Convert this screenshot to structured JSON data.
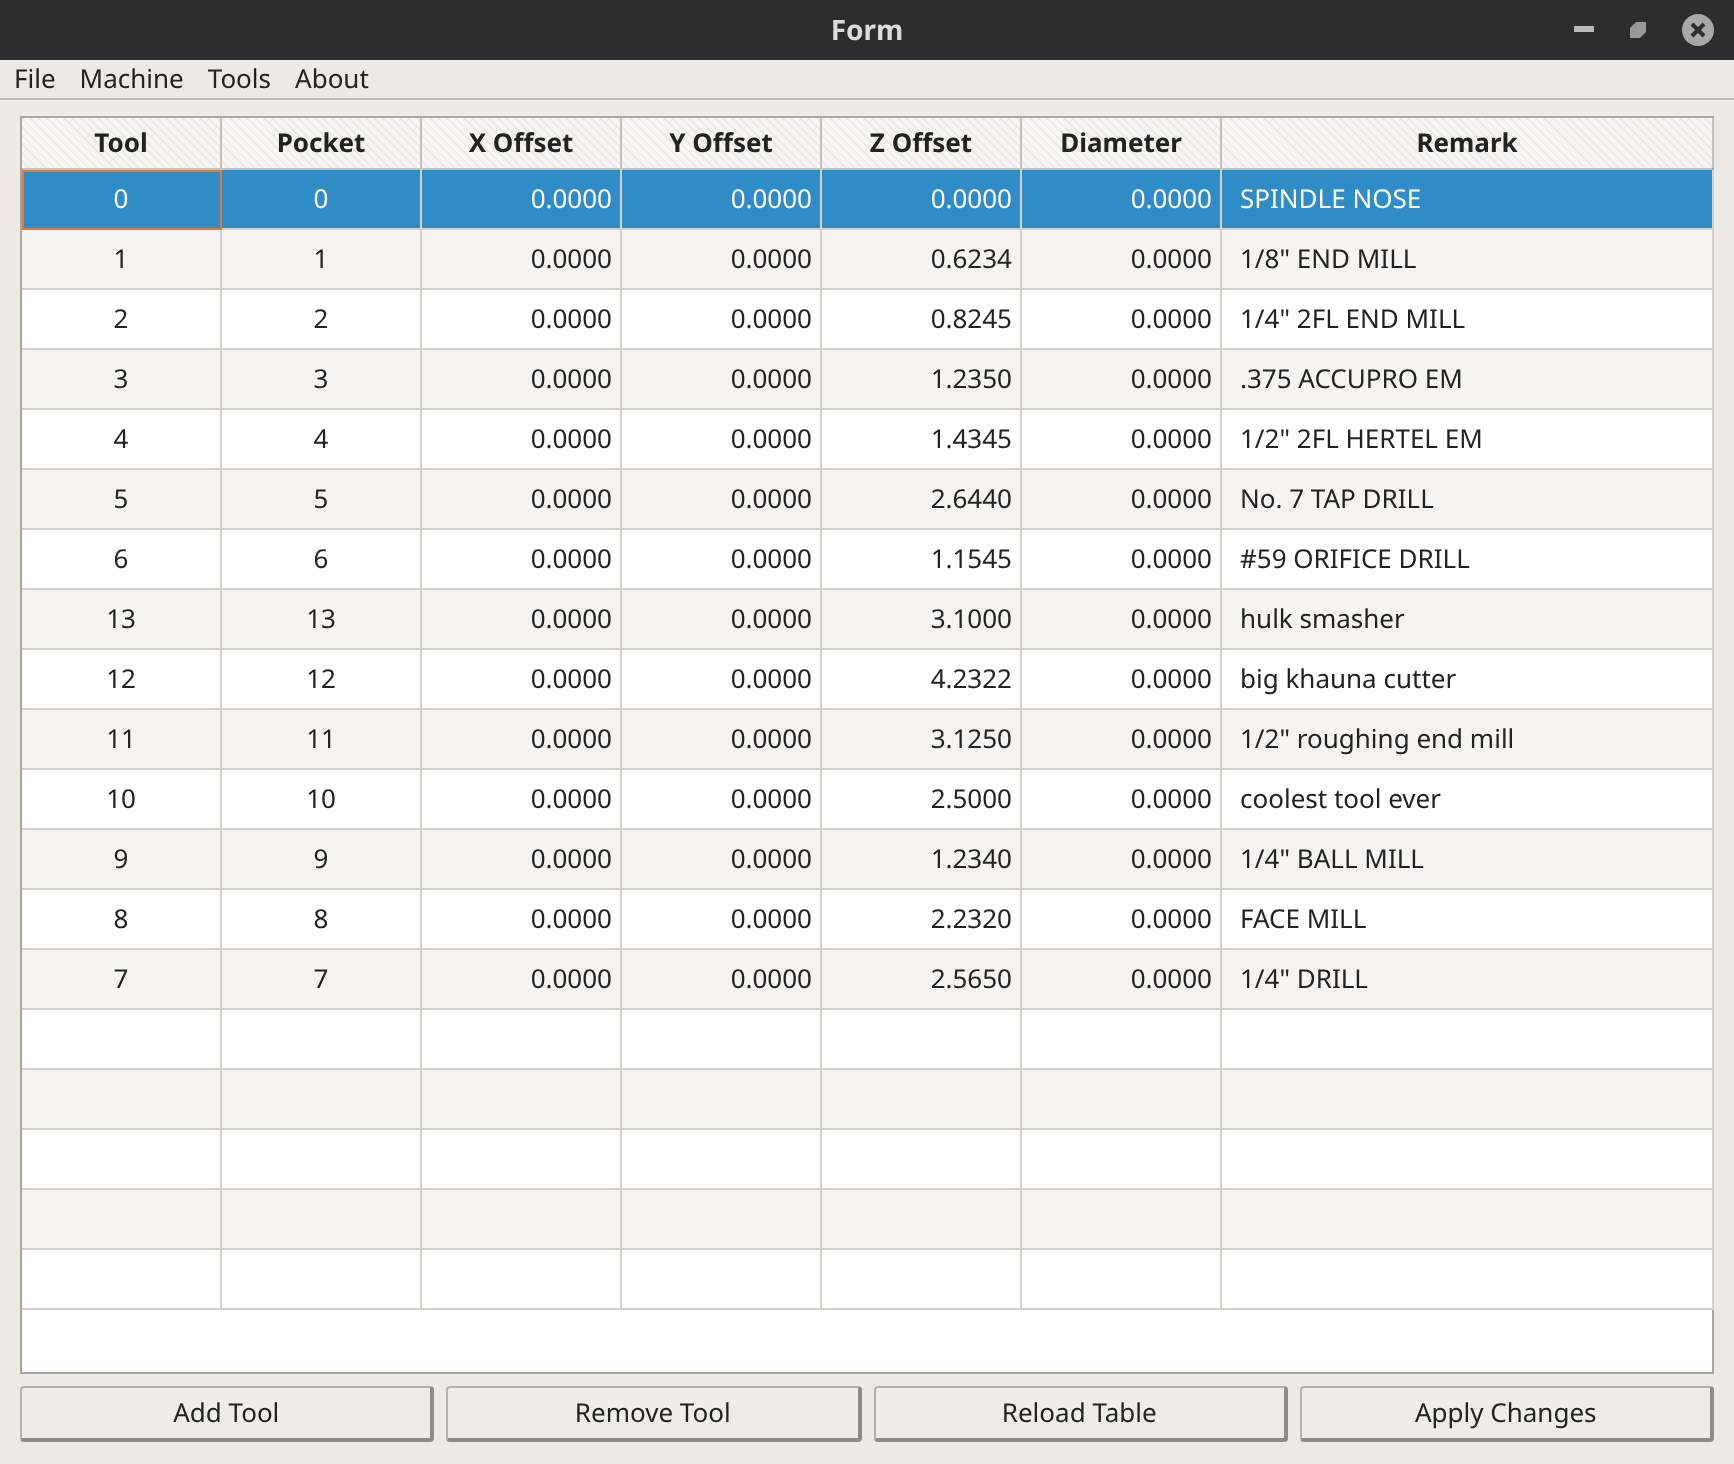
{
  "window": {
    "title": "Form"
  },
  "menu": [
    "File",
    "Machine",
    "Tools",
    "About"
  ],
  "table": {
    "columns": [
      "Tool",
      "Pocket",
      "X Offset",
      "Y Offset",
      "Z Offset",
      "Diameter",
      "Remark"
    ],
    "rows": [
      {
        "cells": [
          "0",
          "0",
          "0.0000",
          "0.0000",
          "0.0000",
          "0.0000",
          "SPINDLE NOSE"
        ],
        "selected": true
      },
      {
        "cells": [
          "1",
          "1",
          "0.0000",
          "0.0000",
          "0.6234",
          "0.0000",
          "1/8\" END MILL"
        ],
        "selected": false
      },
      {
        "cells": [
          "2",
          "2",
          "0.0000",
          "0.0000",
          "0.8245",
          "0.0000",
          "1/4\" 2FL END MILL"
        ],
        "selected": false
      },
      {
        "cells": [
          "3",
          "3",
          "0.0000",
          "0.0000",
          "1.2350",
          "0.0000",
          ".375 ACCUPRO EM"
        ],
        "selected": false
      },
      {
        "cells": [
          "4",
          "4",
          "0.0000",
          "0.0000",
          "1.4345",
          "0.0000",
          "1/2\" 2FL HERTEL EM"
        ],
        "selected": false
      },
      {
        "cells": [
          "5",
          "5",
          "0.0000",
          "0.0000",
          "2.6440",
          "0.0000",
          "No. 7 TAP DRILL"
        ],
        "selected": false
      },
      {
        "cells": [
          "6",
          "6",
          "0.0000",
          "0.0000",
          "1.1545",
          "0.0000",
          "#59 ORIFICE DRILL"
        ],
        "selected": false
      },
      {
        "cells": [
          "13",
          "13",
          "0.0000",
          "0.0000",
          "3.1000",
          "0.0000",
          "hulk smasher"
        ],
        "selected": false
      },
      {
        "cells": [
          "12",
          "12",
          "0.0000",
          "0.0000",
          "4.2322",
          "0.0000",
          "big khauna cutter"
        ],
        "selected": false
      },
      {
        "cells": [
          "11",
          "11",
          "0.0000",
          "0.0000",
          "3.1250",
          "0.0000",
          "1/2\" roughing end mill"
        ],
        "selected": false
      },
      {
        "cells": [
          "10",
          "10",
          "0.0000",
          "0.0000",
          "2.5000",
          "0.0000",
          "coolest tool ever"
        ],
        "selected": false
      },
      {
        "cells": [
          "9",
          "9",
          "0.0000",
          "0.0000",
          "1.2340",
          "0.0000",
          "1/4\" BALL MILL"
        ],
        "selected": false
      },
      {
        "cells": [
          "8",
          "8",
          "0.0000",
          "0.0000",
          "2.2320",
          "0.0000",
          "FACE MILL"
        ],
        "selected": false
      },
      {
        "cells": [
          "7",
          "7",
          "0.0000",
          "0.0000",
          "2.5650",
          "0.0000",
          "1/4\" DRILL"
        ],
        "selected": false
      }
    ]
  },
  "buttons": [
    "Add Tool",
    "Remove Tool",
    "Reload Table",
    "Apply Changes"
  ]
}
